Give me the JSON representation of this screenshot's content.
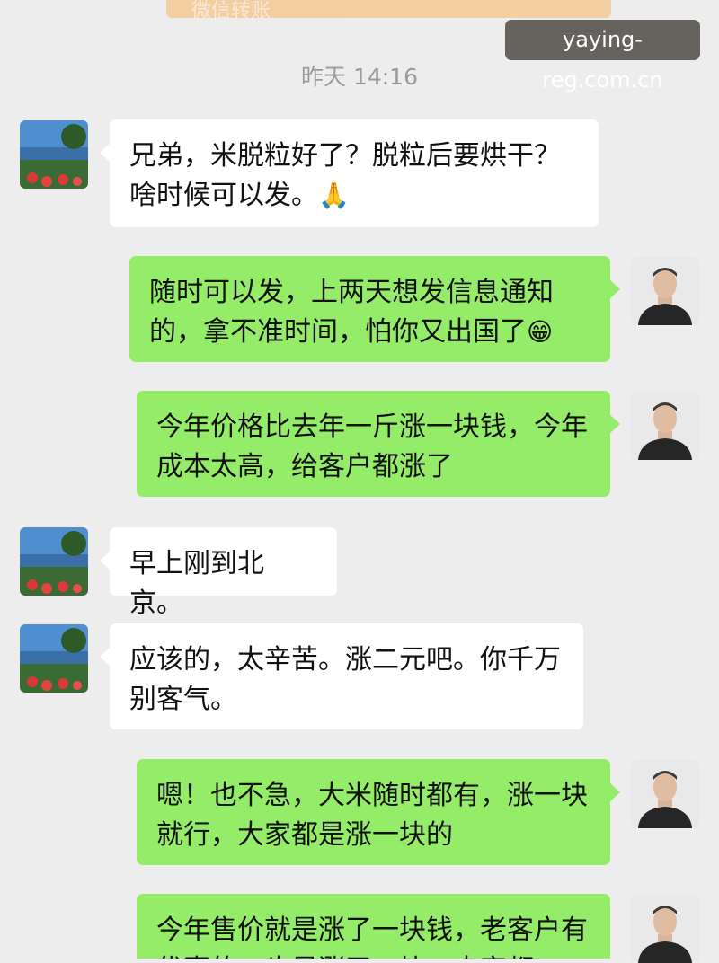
{
  "top_card": {
    "text": "微信转账"
  },
  "watermark": "yaying-reg.com.cn",
  "timestamp": "昨天 14:16",
  "messages": [
    {
      "side": "in",
      "text": "兄弟，米脱粒好了？脱粒后要烘干？啥时候可以发。",
      "emoji": "🙏"
    },
    {
      "side": "out",
      "text": "随时可以发，上两天想发信息通知的，拿不准时间，怕你又出国了",
      "emoji": "😁"
    },
    {
      "side": "out",
      "text": "今年价格比去年一斤涨一块钱，今年成本太高，给客户都涨了"
    },
    {
      "side": "in",
      "text": "早上刚到北京。"
    },
    {
      "side": "in",
      "text": "应该的，太辛苦。涨二元吧。你千万别客气。"
    },
    {
      "side": "out",
      "text": "嗯！也不急，大米随时都有，涨一块就行，大家都是涨一块的"
    },
    {
      "side": "out",
      "text": "今年售价就是涨了一块钱，老客户有优惠的，也是涨了一块，大家都"
    }
  ],
  "colors": {
    "background": "#ededed",
    "incoming_bubble": "#ffffff",
    "outgoing_bubble": "#95ec69"
  }
}
